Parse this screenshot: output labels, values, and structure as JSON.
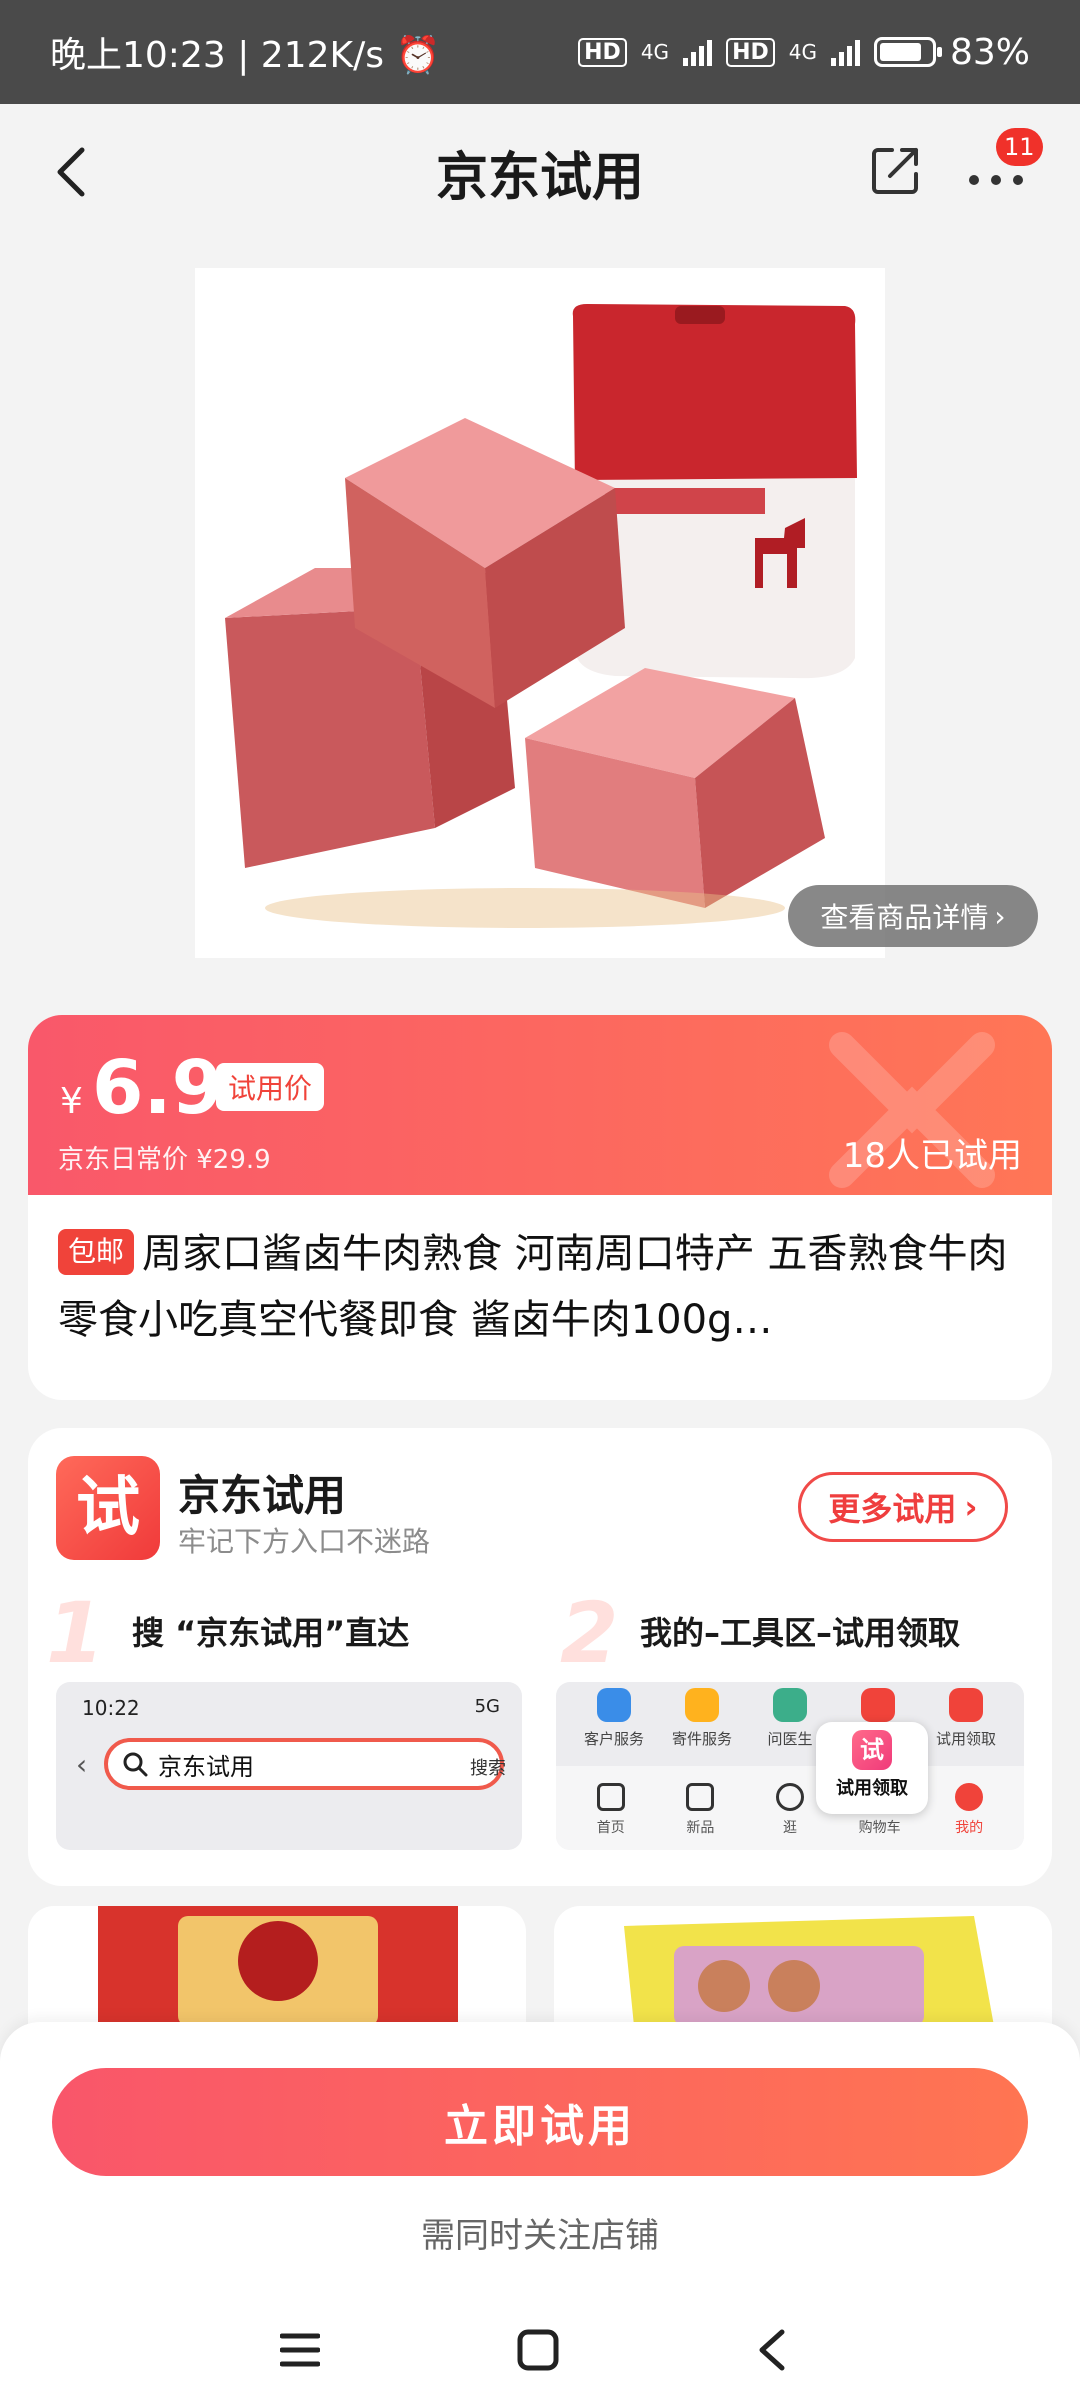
{
  "status_bar": {
    "time": "晚上10:23",
    "speed": "212K/s",
    "battery": "83%",
    "network": "4G"
  },
  "header": {
    "title": "京东试用",
    "badge_count": "11"
  },
  "product": {
    "detail_link": "查看商品详情"
  },
  "price_card": {
    "currency": "¥",
    "price": "6.9",
    "price_tag": "试用价",
    "original_price": "京东日常价 ¥29.9",
    "tried_count": "18人已试用",
    "shipping_tag": "包邮",
    "title": "周家口酱卤牛肉熟食 河南周口特产 五香熟食牛肉零食小吃真空代餐即食 酱卤牛肉100g…"
  },
  "promo": {
    "logo_char": "试",
    "title": "京东试用",
    "subtitle": "牢记下方入口不迷路",
    "more_button": "更多试用",
    "step1_num": "1",
    "step1_label": "搜 “京东试用”直达",
    "step2_num": "2",
    "step2_label": "我的–工具区–试用领取",
    "mock1": {
      "time": "10:22",
      "signal": "5G",
      "search_text": "京东试用",
      "search_button": "搜索"
    },
    "mock2": {
      "icons": [
        "客户服务",
        "寄件服务",
        "问医生",
        "",
        "试用领取"
      ],
      "icon_colors": [
        "#3a8de8",
        "#ffb21e",
        "#3cae8a",
        "#f0433a",
        "#f0433a"
      ],
      "nav": [
        "首页",
        "新品",
        "逛",
        "购物车",
        "我的"
      ],
      "bubble_icon": "试",
      "bubble_label": "试用领取"
    }
  },
  "bottom": {
    "try_button": "立即试用",
    "follow_note": "需同时关注店铺"
  },
  "colors": {
    "accent": "#f9566a",
    "accent_end": "#ff7552",
    "status_bg": "#4a4a4a"
  }
}
